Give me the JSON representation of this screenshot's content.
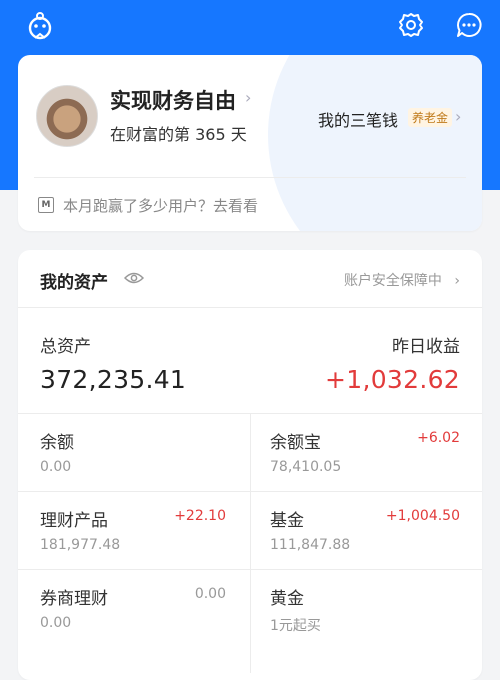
{
  "colors": {
    "brand_blue": "#1677ff",
    "gain_red": "#e23b3b",
    "muted": "#999999"
  },
  "icons": {
    "logo": "mascot-logo-icon",
    "settings": "gear-icon",
    "messages": "chat-bubble-icon",
    "eye": "eye-icon",
    "notice": "m-badge-icon"
  },
  "profile": {
    "name": "实现财务自由",
    "days_text": "在财富的第 365 天",
    "three_money_label": "我的三笔钱",
    "pension_badge": "养老金",
    "notice_text": "本月跑赢了多少用户？去看看",
    "notice_icon_letter": "M"
  },
  "assets": {
    "title": "我的资产",
    "security_text": "账户安全保障中",
    "total_label": "总资产",
    "total_value": "372,235.41",
    "yesterday_label": "昨日收益",
    "yesterday_value": "+1,032.62",
    "items": [
      {
        "title": "余额",
        "sub": "0.00",
        "delta": ""
      },
      {
        "title": "余额宝",
        "sub": "78,410.05",
        "delta": "+6.02"
      },
      {
        "title": "理财产品",
        "sub": "181,977.48",
        "delta": "+22.10"
      },
      {
        "title": "基金",
        "sub": "111,847.88",
        "delta": "+1,004.50"
      },
      {
        "title": "券商理财",
        "sub": "0.00",
        "delta": "0.00"
      },
      {
        "title": "黄金",
        "sub": "1元起买",
        "delta": ""
      }
    ]
  }
}
